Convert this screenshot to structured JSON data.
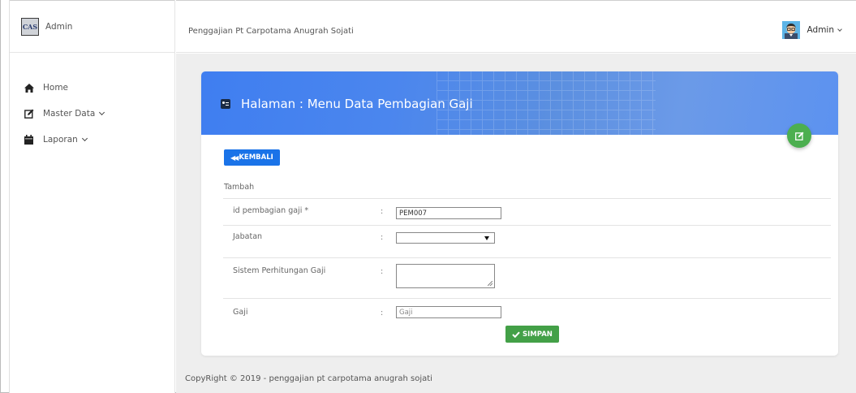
{
  "sidebar": {
    "brand_logo": "CAS",
    "brand_name": "Admin",
    "items": [
      {
        "label": "Home",
        "icon": "home-icon"
      },
      {
        "label": "Master Data",
        "icon": "edit-icon"
      },
      {
        "label": "Laporan",
        "icon": "calendar-icon"
      }
    ]
  },
  "topbar": {
    "title": "Penggajian Pt Carpotama Anugrah Sojati",
    "user_name": "Admin"
  },
  "card": {
    "title": "Halaman : Menu Data Pembagian Gaji",
    "back_label": "KEMBALI",
    "section_label": "Tambah",
    "fields": [
      {
        "label": "id pembagian gaji *",
        "value": "PEM007",
        "placeholder": ""
      },
      {
        "label": "Jabatan",
        "value": ""
      },
      {
        "label": "Sistem Perhitungan Gaji",
        "value": ""
      },
      {
        "label": "Gaji",
        "value": "",
        "placeholder": "Gaji"
      }
    ],
    "colon": ":",
    "save_label": "SIMPAN"
  },
  "footer": {
    "text": "CopyRight © 2019 - penggajian pt carpotama anugrah sojati"
  },
  "colors": {
    "header_blue": "#4b86ee",
    "back_button": "#1a73e8",
    "save_button": "#43a047",
    "fab_green": "#4caf50"
  }
}
